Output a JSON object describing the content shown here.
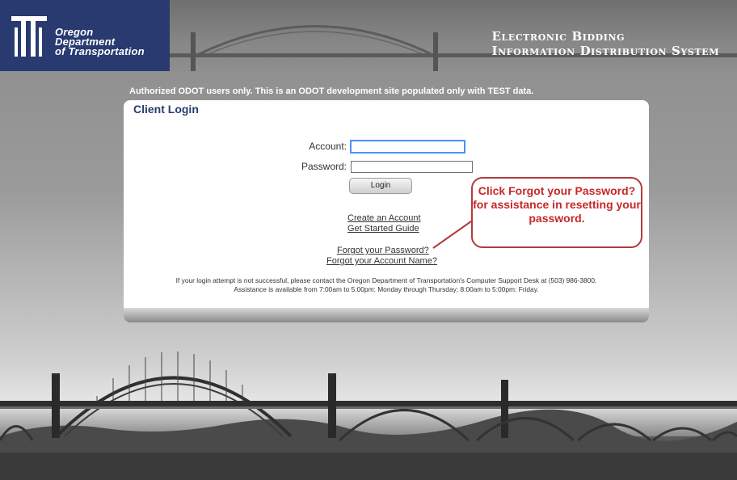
{
  "header": {
    "logo_lines": [
      "Oregon",
      "Department",
      "of Transportation"
    ],
    "system_title_lines": [
      "Electronic Bidding",
      "Information Distribution System"
    ]
  },
  "notice": "Authorized ODOT users only. This is an ODOT development site populated only with TEST data.",
  "login": {
    "title": "Client Login",
    "account_label": "Account:",
    "account_value": "",
    "password_label": "Password:",
    "password_value": "",
    "login_button": "Login",
    "links": {
      "create_account": "Create an Account",
      "get_started": "Get Started Guide",
      "forgot_password": "Forgot your Password?",
      "forgot_account": "Forgot your Account Name?"
    },
    "help_lines": [
      "If your login attempt is not successful, please contact the Oregon Department of Transportation's Computer Support Desk at (503) 986-3800.",
      "Assistance is available from 7:00am to 5:00pm: Monday through Thursday; 8:00am to 5:00pm: Friday."
    ]
  },
  "callout": {
    "text": "Click Forgot your Password? for assistance in resetting your password.",
    "color": "#c62828"
  },
  "colors": {
    "brand_navy": "#283a70",
    "panel": "#ffffff"
  }
}
